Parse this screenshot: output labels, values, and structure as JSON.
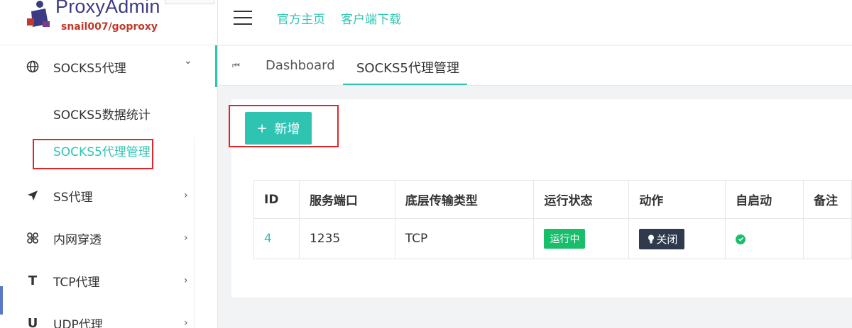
{
  "brand": {
    "title": "ProxyAdmin",
    "subtitle": "snail007/goproxy"
  },
  "header": {
    "links": [
      "官方主页",
      "客户端下载"
    ]
  },
  "sidebar": {
    "items": [
      {
        "label": "SOCKS5代理",
        "icon": "globe-icon",
        "arrow": "⌄",
        "expanded": true
      },
      {
        "label": "SS代理",
        "icon": "send-icon",
        "arrow": "›"
      },
      {
        "label": "内网穿透",
        "icon": "network-icon",
        "arrow": "›"
      },
      {
        "label": "TCP代理",
        "icon": "tcp-icon",
        "glyph": "T",
        "arrow": "›"
      },
      {
        "label": "UDP代理",
        "icon": "udp-icon",
        "glyph": "U",
        "arrow": "›"
      }
    ],
    "submenu": [
      {
        "label": "SOCKS5数据统计",
        "active": false
      },
      {
        "label": "SOCKS5代理管理",
        "active": true
      }
    ]
  },
  "tabs": {
    "prev_icon": "⏮",
    "items": [
      {
        "label": "Dashboard",
        "active": false
      },
      {
        "label": "SOCKS5代理管理",
        "active": true
      }
    ]
  },
  "toolbar": {
    "add_icon": "+",
    "add_label": "新增"
  },
  "table": {
    "columns": [
      "ID",
      "服务端口",
      "底层传输类型",
      "运行状态",
      "动作",
      "自启动",
      "备注"
    ],
    "rows": [
      {
        "id": "4",
        "port": "1235",
        "transport": "TCP",
        "status": "运行中",
        "action_label": "关闭",
        "autostart": true,
        "note": ""
      }
    ]
  },
  "colors": {
    "accent": "#2fc4b2",
    "success": "#19be6b",
    "dark_button": "#2f3b4c",
    "highlight": "#e0262a"
  }
}
